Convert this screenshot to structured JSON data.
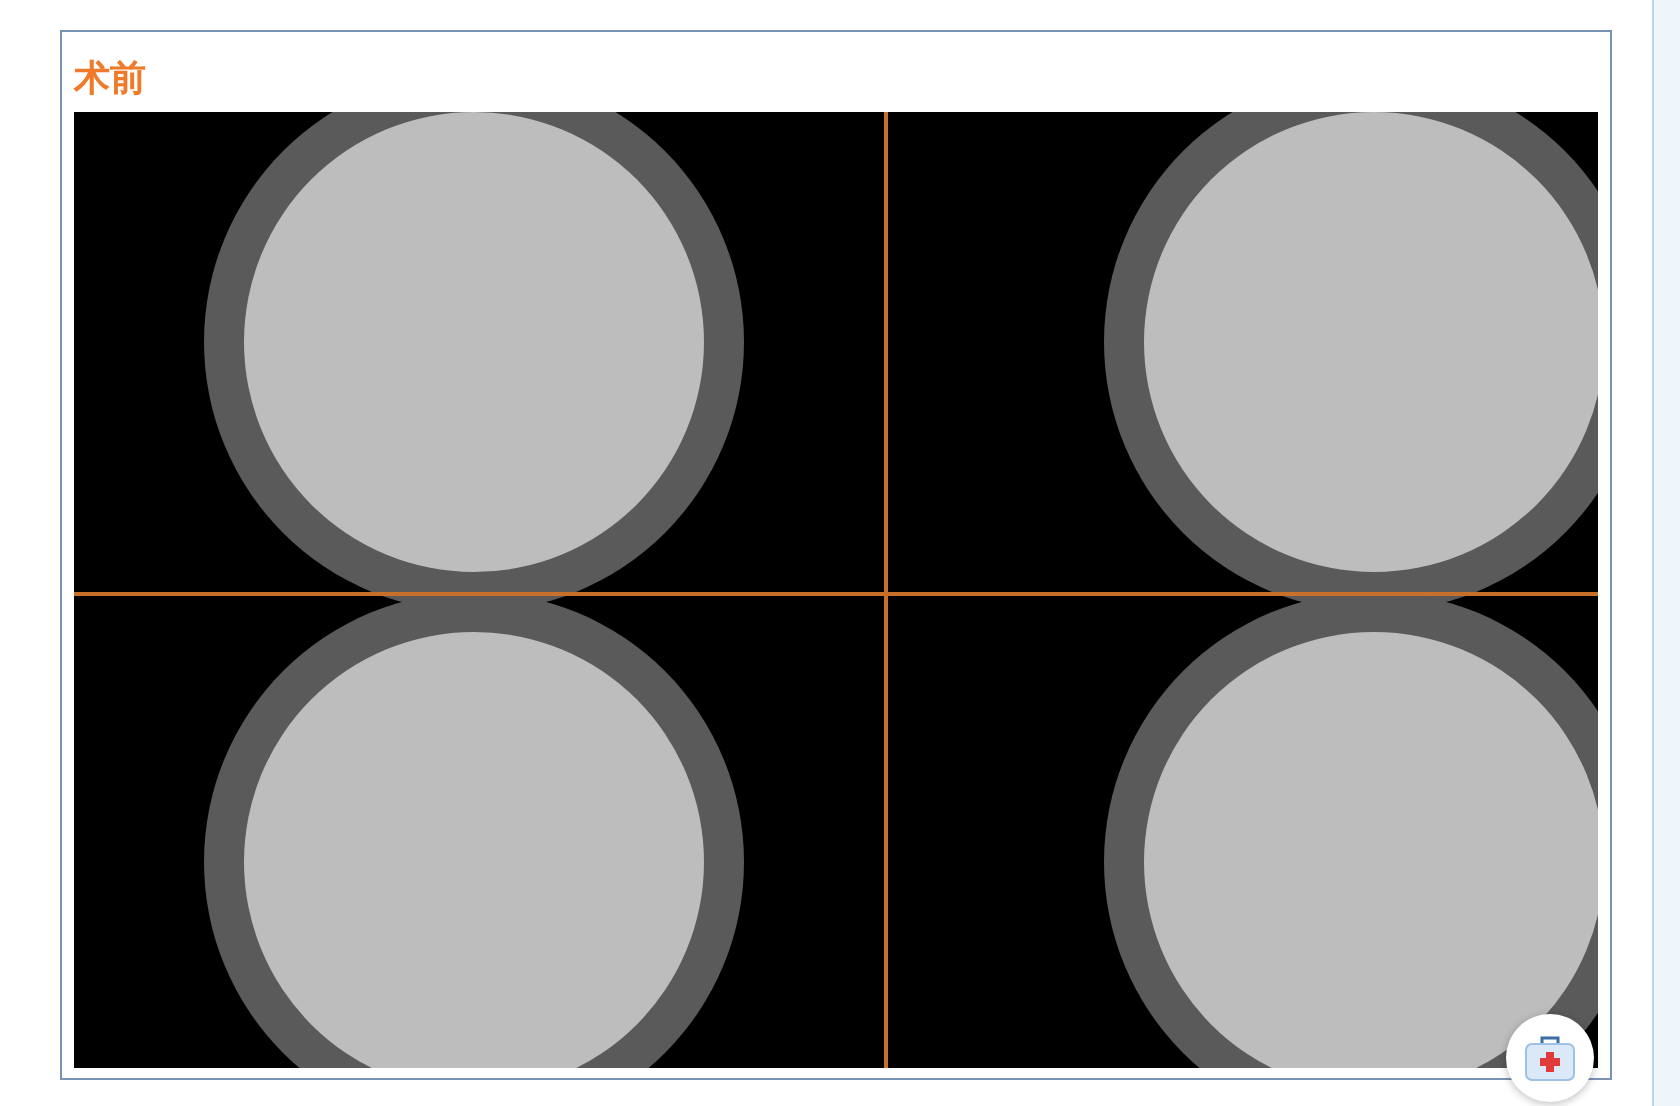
{
  "section": {
    "title": "术前"
  }
}
